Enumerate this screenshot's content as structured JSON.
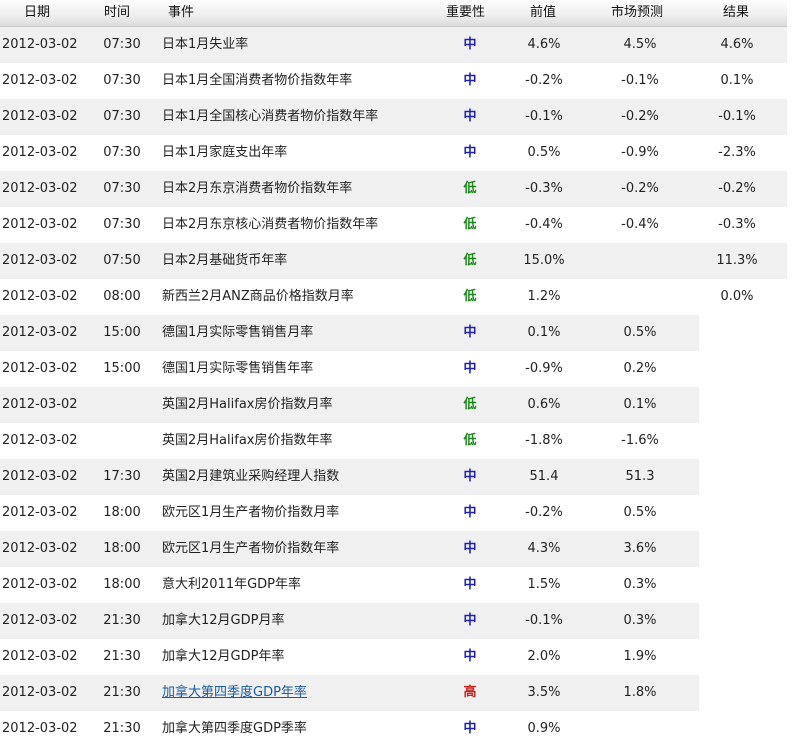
{
  "columns": {
    "date": "日期",
    "time": "时间",
    "event": "事件",
    "importance": "重要性",
    "previous": "前值",
    "forecast": "市场预测",
    "result": "结果"
  },
  "colors": {
    "importance_medium": "#1f1fb8",
    "importance_low": "#1a8a1a",
    "importance_high": "#cc1f1f",
    "row_shade": "#f0f0f0",
    "link": "#1a5aa0"
  },
  "rows": [
    {
      "date": "2012-03-02",
      "time": "07:30",
      "event": "日本1月失业率",
      "importance": "中",
      "level": "medium",
      "previous": "4.6%",
      "forecast": "4.5%",
      "result": "4.6%",
      "link": false,
      "has_result": true
    },
    {
      "date": "2012-03-02",
      "time": "07:30",
      "event": "日本1月全国消费者物价指数年率",
      "importance": "中",
      "level": "medium",
      "previous": "-0.2%",
      "forecast": "-0.1%",
      "result": "0.1%",
      "link": false,
      "has_result": true
    },
    {
      "date": "2012-03-02",
      "time": "07:30",
      "event": "日本1月全国核心消费者物价指数年率",
      "importance": "中",
      "level": "medium",
      "previous": "-0.1%",
      "forecast": "-0.2%",
      "result": "-0.1%",
      "link": false,
      "has_result": true
    },
    {
      "date": "2012-03-02",
      "time": "07:30",
      "event": "日本1月家庭支出年率",
      "importance": "中",
      "level": "medium",
      "previous": "0.5%",
      "forecast": "-0.9%",
      "result": "-2.3%",
      "link": false,
      "has_result": true
    },
    {
      "date": "2012-03-02",
      "time": "07:30",
      "event": "日本2月东京消费者物价指数年率",
      "importance": "低",
      "level": "low",
      "previous": "-0.3%",
      "forecast": "-0.2%",
      "result": "-0.2%",
      "link": false,
      "has_result": true
    },
    {
      "date": "2012-03-02",
      "time": "07:30",
      "event": "日本2月东京核心消费者物价指数年率",
      "importance": "低",
      "level": "low",
      "previous": "-0.4%",
      "forecast": "-0.4%",
      "result": "-0.3%",
      "link": false,
      "has_result": true
    },
    {
      "date": "2012-03-02",
      "time": "07:50",
      "event": "日本2月基础货币年率",
      "importance": "低",
      "level": "low",
      "previous": "15.0%",
      "forecast": "",
      "result": "11.3%",
      "link": false,
      "has_result": true
    },
    {
      "date": "2012-03-02",
      "time": "08:00",
      "event": "新西兰2月ANZ商品价格指数月率",
      "importance": "低",
      "level": "low",
      "previous": "1.2%",
      "forecast": "",
      "result": "0.0%",
      "link": false,
      "has_result": true
    },
    {
      "date": "2012-03-02",
      "time": "15:00",
      "event": "德国1月实际零售销售月率",
      "importance": "中",
      "level": "medium",
      "previous": "0.1%",
      "forecast": "0.5%",
      "result": "",
      "link": false,
      "has_result": false
    },
    {
      "date": "2012-03-02",
      "time": "15:00",
      "event": "德国1月实际零售销售年率",
      "importance": "中",
      "level": "medium",
      "previous": "-0.9%",
      "forecast": "0.2%",
      "result": "",
      "link": false,
      "has_result": false
    },
    {
      "date": "2012-03-02",
      "time": "",
      "event": "英国2月Halifax房价指数月率",
      "importance": "低",
      "level": "low",
      "previous": "0.6%",
      "forecast": "0.1%",
      "result": "",
      "link": false,
      "has_result": false
    },
    {
      "date": "2012-03-02",
      "time": "",
      "event": "英国2月Halifax房价指数年率",
      "importance": "低",
      "level": "low",
      "previous": "-1.8%",
      "forecast": "-1.6%",
      "result": "",
      "link": false,
      "has_result": false
    },
    {
      "date": "2012-03-02",
      "time": "17:30",
      "event": "英国2月建筑业采购经理人指数",
      "importance": "中",
      "level": "medium",
      "previous": "51.4",
      "forecast": "51.3",
      "result": "",
      "link": false,
      "has_result": false
    },
    {
      "date": "2012-03-02",
      "time": "18:00",
      "event": "欧元区1月生产者物价指数月率",
      "importance": "中",
      "level": "medium",
      "previous": "-0.2%",
      "forecast": "0.5%",
      "result": "",
      "link": false,
      "has_result": false
    },
    {
      "date": "2012-03-02",
      "time": "18:00",
      "event": "欧元区1月生产者物价指数年率",
      "importance": "中",
      "level": "medium",
      "previous": "4.3%",
      "forecast": "3.6%",
      "result": "",
      "link": false,
      "has_result": false
    },
    {
      "date": "2012-03-02",
      "time": "18:00",
      "event": "意大利2011年GDP年率",
      "importance": "中",
      "level": "medium",
      "previous": "1.5%",
      "forecast": "0.3%",
      "result": "",
      "link": false,
      "has_result": false
    },
    {
      "date": "2012-03-02",
      "time": "21:30",
      "event": "加拿大12月GDP月率",
      "importance": "中",
      "level": "medium",
      "previous": "-0.1%",
      "forecast": "0.3%",
      "result": "",
      "link": false,
      "has_result": false
    },
    {
      "date": "2012-03-02",
      "time": "21:30",
      "event": "加拿大12月GDP年率",
      "importance": "中",
      "level": "medium",
      "previous": "2.0%",
      "forecast": "1.9%",
      "result": "",
      "link": false,
      "has_result": false
    },
    {
      "date": "2012-03-02",
      "time": "21:30",
      "event": "加拿大第四季度GDP年率",
      "importance": "高",
      "level": "high",
      "previous": "3.5%",
      "forecast": "1.8%",
      "result": "",
      "link": true,
      "has_result": false
    },
    {
      "date": "2012-03-02",
      "time": "21:30",
      "event": "加拿大第四季度GDP季率",
      "importance": "中",
      "level": "medium",
      "previous": "0.9%",
      "forecast": "",
      "result": "",
      "link": false,
      "has_result": false
    }
  ]
}
